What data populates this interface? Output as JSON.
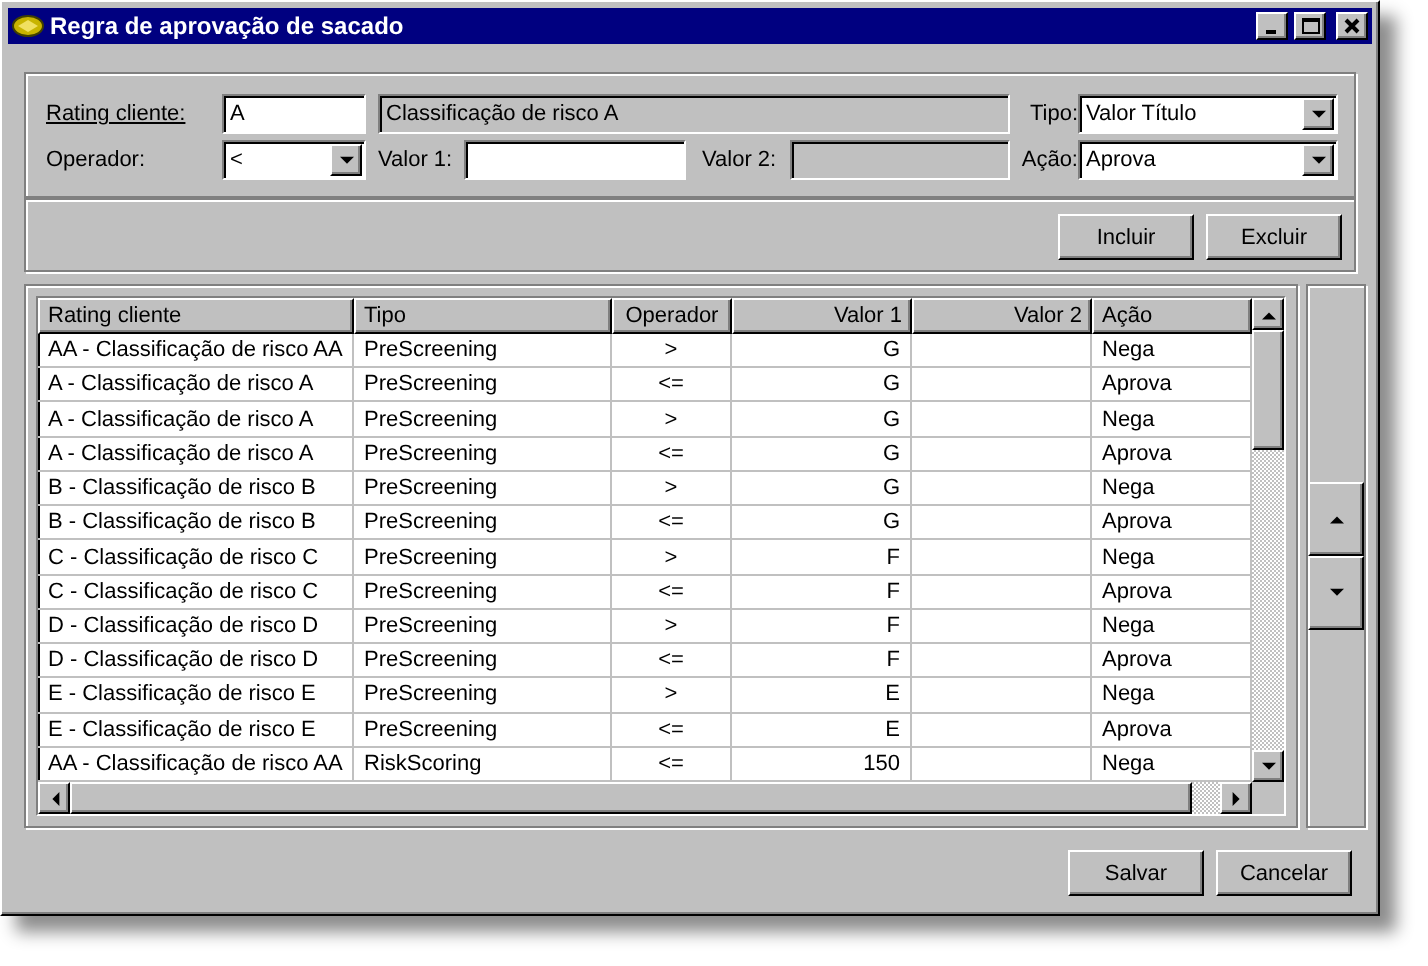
{
  "window": {
    "title": "Regra de aprovação de sacado"
  },
  "form": {
    "rating_label": "Rating cliente:",
    "rating_value": "A",
    "rating_description": "Classificação de risco A",
    "tipo_label": "Tipo:",
    "tipo_value": "Valor Título",
    "operador_label": "Operador:",
    "operador_value": "<",
    "valor1_label": "Valor 1:",
    "valor2_label": "Valor 2:",
    "acao_label": "Ação:",
    "acao_value": "Aprova"
  },
  "actions": [
    "Incluir",
    "Excluir"
  ],
  "table": {
    "columns": [
      "Rating cliente",
      "Tipo",
      "Operador",
      "Valor 1",
      "Valor 2",
      "Ação"
    ],
    "rows": [
      [
        "AA - Classificação de risco AA",
        "PreScreening",
        ">",
        "G",
        "",
        "Nega"
      ],
      [
        "A - Classificação de risco A",
        "PreScreening",
        "<=",
        "G",
        "",
        "Aprova"
      ],
      [
        "A - Classificação de risco A",
        "PreScreening",
        ">",
        "G",
        "",
        "Nega"
      ],
      [
        "A - Classificação de risco A",
        "PreScreening",
        "<=",
        "G",
        "",
        "Aprova"
      ],
      [
        "B - Classificação de risco B",
        "PreScreening",
        ">",
        "G",
        "",
        "Nega"
      ],
      [
        "B - Classificação de risco B",
        "PreScreening",
        "<=",
        "G",
        "",
        "Aprova"
      ],
      [
        "C - Classificação de risco C",
        "PreScreening",
        ">",
        "F",
        "",
        "Nega"
      ],
      [
        "C - Classificação de risco C",
        "PreScreening",
        "<=",
        "F",
        "",
        "Aprova"
      ],
      [
        "D - Classificação de risco D",
        "PreScreening",
        ">",
        "F",
        "",
        "Nega"
      ],
      [
        "D - Classificação de risco D",
        "PreScreening",
        "<=",
        "F",
        "",
        "Aprova"
      ],
      [
        "E - Classificação de risco E",
        "PreScreening",
        ">",
        "E",
        "",
        "Nega"
      ],
      [
        "E - Classificação de risco E",
        "PreScreening",
        "<=",
        "E",
        "",
        "Aprova"
      ],
      [
        "AA - Classificação de risco AA",
        "RiskScoring",
        "<=",
        "150",
        "",
        "Nega"
      ]
    ]
  },
  "footer": [
    "Salvar",
    "Cancelar"
  ]
}
